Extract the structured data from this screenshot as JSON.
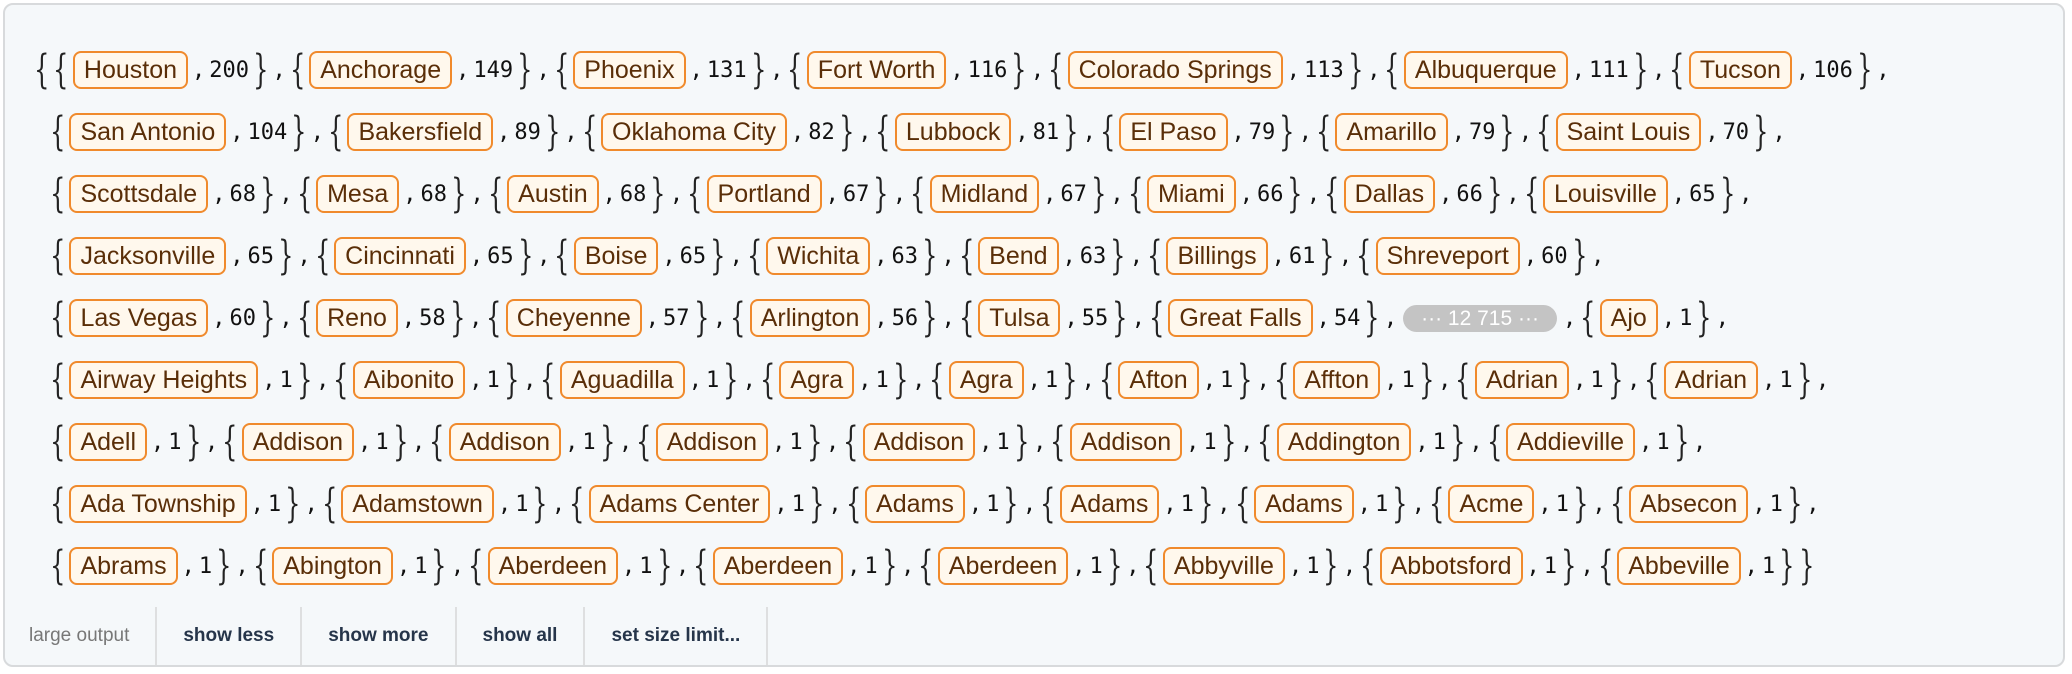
{
  "output": {
    "visible_pairs_head": [
      [
        "Houston",
        "200"
      ],
      [
        "Anchorage",
        "149"
      ],
      [
        "Phoenix",
        "131"
      ],
      [
        "Fort Worth",
        "116"
      ],
      [
        "Colorado Springs",
        "113"
      ],
      [
        "Albuquerque",
        "111"
      ],
      [
        "Tucson",
        "106"
      ],
      [
        "San Antonio",
        "104"
      ],
      [
        "Bakersfield",
        "89"
      ],
      [
        "Oklahoma City",
        "82"
      ],
      [
        "Lubbock",
        "81"
      ],
      [
        "El Paso",
        "79"
      ],
      [
        "Amarillo",
        "79"
      ],
      [
        "Saint Louis",
        "70"
      ],
      [
        "Scottsdale",
        "68"
      ],
      [
        "Mesa",
        "68"
      ],
      [
        "Austin",
        "68"
      ],
      [
        "Portland",
        "67"
      ],
      [
        "Midland",
        "67"
      ],
      [
        "Miami",
        "66"
      ],
      [
        "Dallas",
        "66"
      ],
      [
        "Louisville",
        "65"
      ],
      [
        "Jacksonville",
        "65"
      ],
      [
        "Cincinnati",
        "65"
      ],
      [
        "Boise",
        "65"
      ],
      [
        "Wichita",
        "63"
      ],
      [
        "Bend",
        "63"
      ],
      [
        "Billings",
        "61"
      ],
      [
        "Shreveport",
        "60"
      ],
      [
        "Las Vegas",
        "60"
      ],
      [
        "Reno",
        "58"
      ],
      [
        "Cheyenne",
        "57"
      ],
      [
        "Arlington",
        "56"
      ],
      [
        "Tulsa",
        "55"
      ],
      [
        "Great Falls",
        "54"
      ]
    ],
    "elided_count": "··· 12 715 ···",
    "visible_pairs_tail": [
      [
        "Ajo",
        "1"
      ],
      [
        "Airway Heights",
        "1"
      ],
      [
        "Aibonito",
        "1"
      ],
      [
        "Aguadilla",
        "1"
      ],
      [
        "Agra",
        "1"
      ],
      [
        "Agra",
        "1"
      ],
      [
        "Afton",
        "1"
      ],
      [
        "Affton",
        "1"
      ],
      [
        "Adrian",
        "1"
      ],
      [
        "Adrian",
        "1"
      ],
      [
        "Adell",
        "1"
      ],
      [
        "Addison",
        "1"
      ],
      [
        "Addison",
        "1"
      ],
      [
        "Addison",
        "1"
      ],
      [
        "Addison",
        "1"
      ],
      [
        "Addison",
        "1"
      ],
      [
        "Addington",
        "1"
      ],
      [
        "Addieville",
        "1"
      ],
      [
        "Ada Township",
        "1"
      ],
      [
        "Adamstown",
        "1"
      ],
      [
        "Adams Center",
        "1"
      ],
      [
        "Adams",
        "1"
      ],
      [
        "Adams",
        "1"
      ],
      [
        "Adams",
        "1"
      ],
      [
        "Acme",
        "1"
      ],
      [
        "Absecon",
        "1"
      ],
      [
        "Abrams",
        "1"
      ],
      [
        "Abington",
        "1"
      ],
      [
        "Aberdeen",
        "1"
      ],
      [
        "Aberdeen",
        "1"
      ],
      [
        "Aberdeen",
        "1"
      ],
      [
        "Abbyville",
        "1"
      ],
      [
        "Abbotsford",
        "1"
      ],
      [
        "Abbeville",
        "1"
      ]
    ]
  },
  "footer": {
    "label": "large output",
    "show_less": "show less",
    "show_more": "show more",
    "show_all": "show all",
    "set_size_limit": "set size limit..."
  }
}
